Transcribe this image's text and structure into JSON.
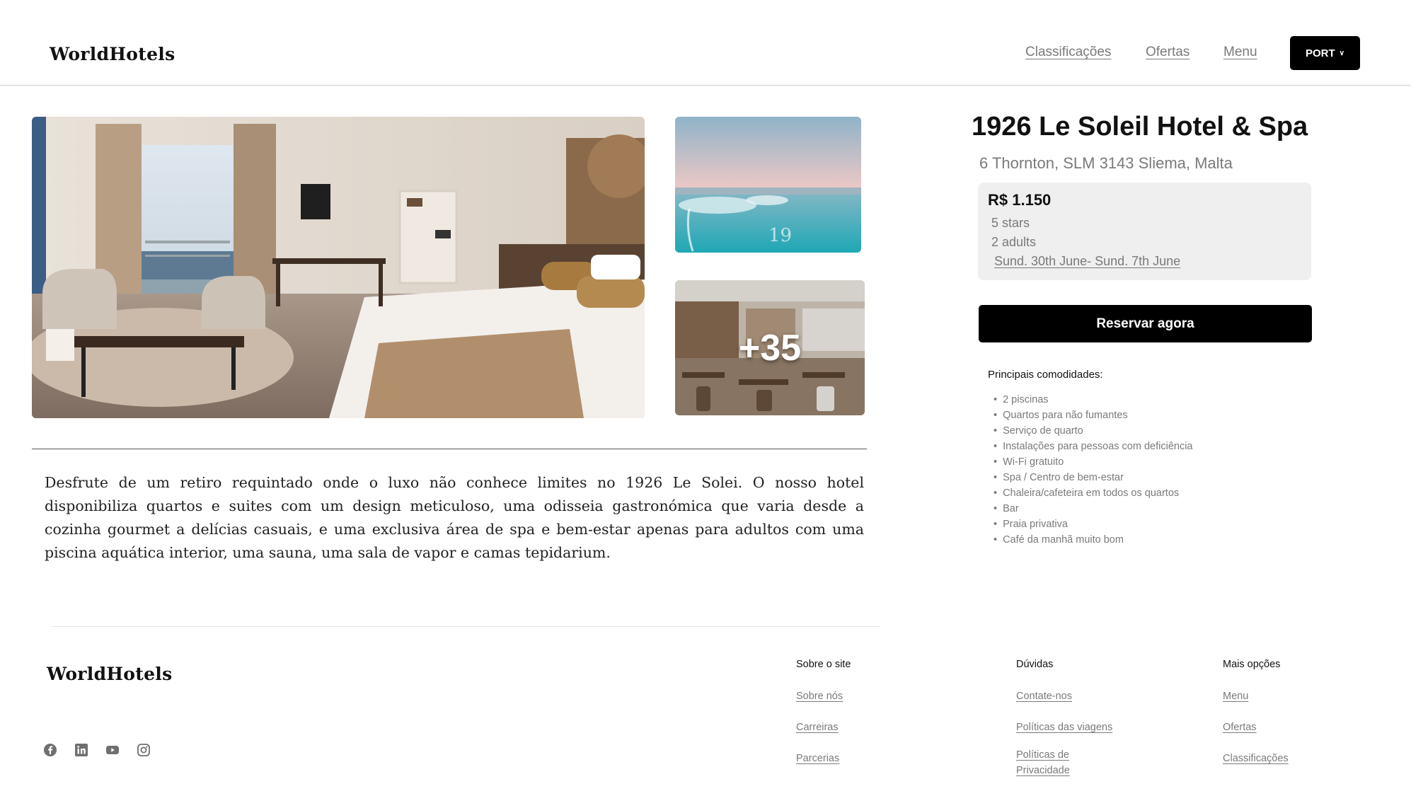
{
  "header": {
    "logo": "WorldHotels",
    "nav": [
      "Classificações",
      "Ofertas",
      "Menu"
    ],
    "language_button": "PORT",
    "language_chevron": "∨"
  },
  "gallery": {
    "more_photos_label": "+35"
  },
  "description": "Desfrute de um retiro requintado onde o luxo não conhece limites no 1926 Le Solei. O nosso hotel disponibiliza quartos e suites com um design meticuloso, uma odisseia gastronómica que varia desde a cozinha gourmet a delícias casuais, e uma exclusiva área de spa e bem-estar apenas para adultos com uma piscina aquática interior, uma sauna, uma sala de vapor e camas tepidarium.",
  "hotel": {
    "name": "1926 Le Soleil Hotel & Spa",
    "address": "6 Thornton, SLM 3143 Sliema, Malta",
    "price": "R$ 1.150",
    "stars": "5 stars",
    "guests": "2 adults",
    "dates": "Sund. 30th June- Sund. 7th June",
    "book_button": "Reservar agora",
    "amenities_title": "Principais comodidades:",
    "amenities": [
      "2 piscinas",
      "Quartos para não fumantes",
      "Serviço de quarto",
      "Instalações para pessoas com deficiência",
      "Wi-Fi gratuito",
      "Spa / Centro de bem-estar",
      "Chaleira/cafeteira em todos os quartos",
      "Bar",
      "Praia privativa",
      "Café da manhã muito bom"
    ]
  },
  "footer": {
    "logo": "WorldHotels",
    "social_icons": [
      "facebook-icon",
      "linkedin-icon",
      "youtube-icon",
      "instagram-icon"
    ],
    "columns": [
      {
        "title": "Sobre o site",
        "links": [
          "Sobre nós",
          "Carreiras",
          "Parcerias"
        ]
      },
      {
        "title": "Dúvidas",
        "links": [
          "Contate-nos",
          "Políticas das viagens",
          "Políticas de Privacidade"
        ]
      },
      {
        "title": "Mais opções",
        "links": [
          "Menu",
          "Ofertas",
          "Classificações"
        ]
      }
    ]
  },
  "colors": {
    "primary": "#000000",
    "muted_text": "#7a7a7a",
    "panel_bg": "#efefef"
  }
}
